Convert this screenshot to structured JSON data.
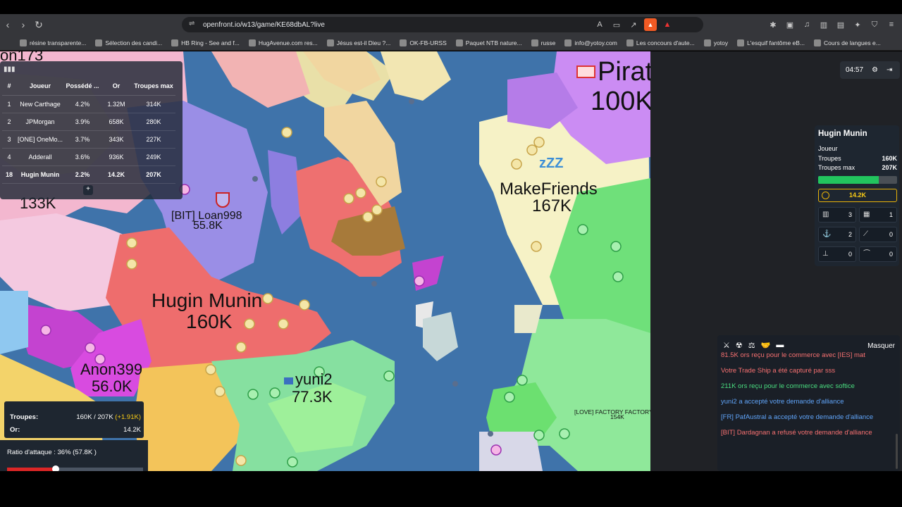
{
  "browser": {
    "url": "openfront.io/w13/game/KE68dbAL?live",
    "bookmarks": [
      "résine transparente...",
      "Sélection des candi...",
      "HB Ring - See and f...",
      "HugAvenue.com res...",
      "Jésus est-il Dieu ?...",
      "OK-FB-URSS",
      "Paquet NTB nature...",
      "russe",
      "info@yotoy.com",
      "Les concours d'aute...",
      "yotoy",
      "L'esquif fantôme eB...",
      "Cours de langues e..."
    ]
  },
  "map": {
    "labels": {
      "anon173_top": "on173",
      "anon173_troops": "133K",
      "pirat_name": "Pirat",
      "pirat_troops": "100K",
      "makefriends_name": "MakeFriends",
      "makefriends_troops": "167K",
      "loan_name": "[BIT] Loan998",
      "loan_troops": "55.8K",
      "hugin_name": "Hugin Munin",
      "hugin_troops": "160K",
      "anon399_name": "Anon399",
      "anon399_troops": "56.0K",
      "yuni_name": "yuni2",
      "yuni_troops": "77.3K",
      "factory_name": "[LOVE] FACTORY FACTORY",
      "factory_troops": "154K"
    }
  },
  "leaderboard": {
    "headers": [
      "#",
      "Joueur",
      "Possédé ...",
      "Or",
      "Troupes max"
    ],
    "rows": [
      {
        "rank": "1",
        "player": "New Carthage",
        "owned": "4.2%",
        "gold": "1.32M",
        "max": "314K"
      },
      {
        "rank": "2",
        "player": "JPMorgan",
        "owned": "3.9%",
        "gold": "658K",
        "max": "280K"
      },
      {
        "rank": "3",
        "player": "[ONE] OneMo...",
        "owned": "3.7%",
        "gold": "343K",
        "max": "227K"
      },
      {
        "rank": "4",
        "player": "Adderall",
        "owned": "3.6%",
        "gold": "936K",
        "max": "249K"
      },
      {
        "rank": "18",
        "player": "Hugin Munin",
        "owned": "2.2%",
        "gold": "14.2K",
        "max": "207K"
      }
    ],
    "expand": "+"
  },
  "timer": "04:57",
  "player_panel": {
    "name": "Hugin Munin",
    "player_label": "Joueur",
    "troops_label": "Troupes",
    "troops_value": "160K",
    "max_label": "Troupes max",
    "max_value": "207K",
    "troop_fill": 0.77,
    "gold": "14.2K",
    "buildings": [
      {
        "icon": "city-icon",
        "value": "3"
      },
      {
        "icon": "factory-icon",
        "value": "1"
      },
      {
        "icon": "port-icon",
        "value": "2"
      },
      {
        "icon": "missile-silo-icon",
        "value": "0"
      },
      {
        "icon": "sam-launcher-icon",
        "value": "0"
      },
      {
        "icon": "defense-post-icon",
        "value": "0"
      }
    ]
  },
  "chat": {
    "hide_label": "Masquer",
    "messages": [
      {
        "text": "81.5K ors reçu pour le commerce avec [IES] mat",
        "color": "#f87171"
      },
      {
        "text": "Votre Trade Ship a été capturé par sss",
        "color": "#f87171"
      },
      {
        "text": "211K ors reçu pour le commerce avec softice",
        "color": "#4ade80"
      },
      {
        "text": "yuni2 a accepté votre demande d'alliance",
        "color": "#60a5fa"
      },
      {
        "text": "[FR] PafAustral a accepté votre demande d'alliance",
        "color": "#60a5fa"
      },
      {
        "text": "[BIT] Dardagnan a refusé votre demande d'alliance",
        "color": "#f87171"
      }
    ]
  },
  "stats": {
    "troops_label": "Troupes:",
    "troops_value": "160K / 207K",
    "troops_gain": "(+1.91K)",
    "gold_label": "Or:",
    "gold_value": "14.2K"
  },
  "attack": {
    "label": "Ratio d'attaque : 36% (57.8K )",
    "ratio": 0.36
  }
}
